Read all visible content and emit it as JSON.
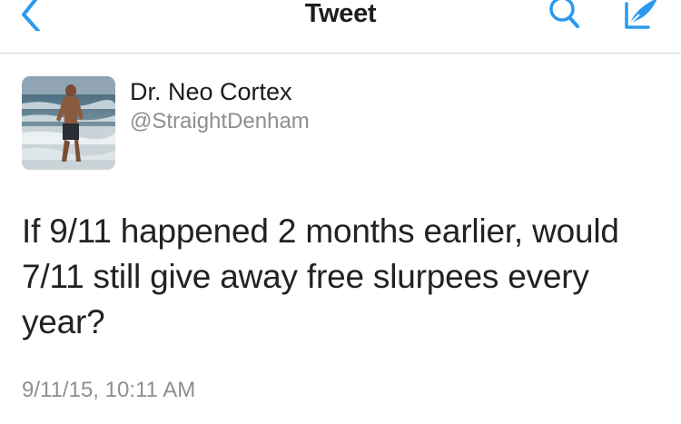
{
  "navbar": {
    "title": "Tweet",
    "back_icon": "chevron-left-icon",
    "search_icon": "search-icon",
    "compose_icon": "compose-icon",
    "accent_color": "#2a9af0"
  },
  "tweet": {
    "author_name": "Dr. Neo Cortex",
    "author_handle": "@StraightDenham",
    "text": "If 9/11 happened 2 months earlier, would 7/11 still give away free slurpees every year?",
    "timestamp": "9/11/15, 10:11 AM"
  }
}
